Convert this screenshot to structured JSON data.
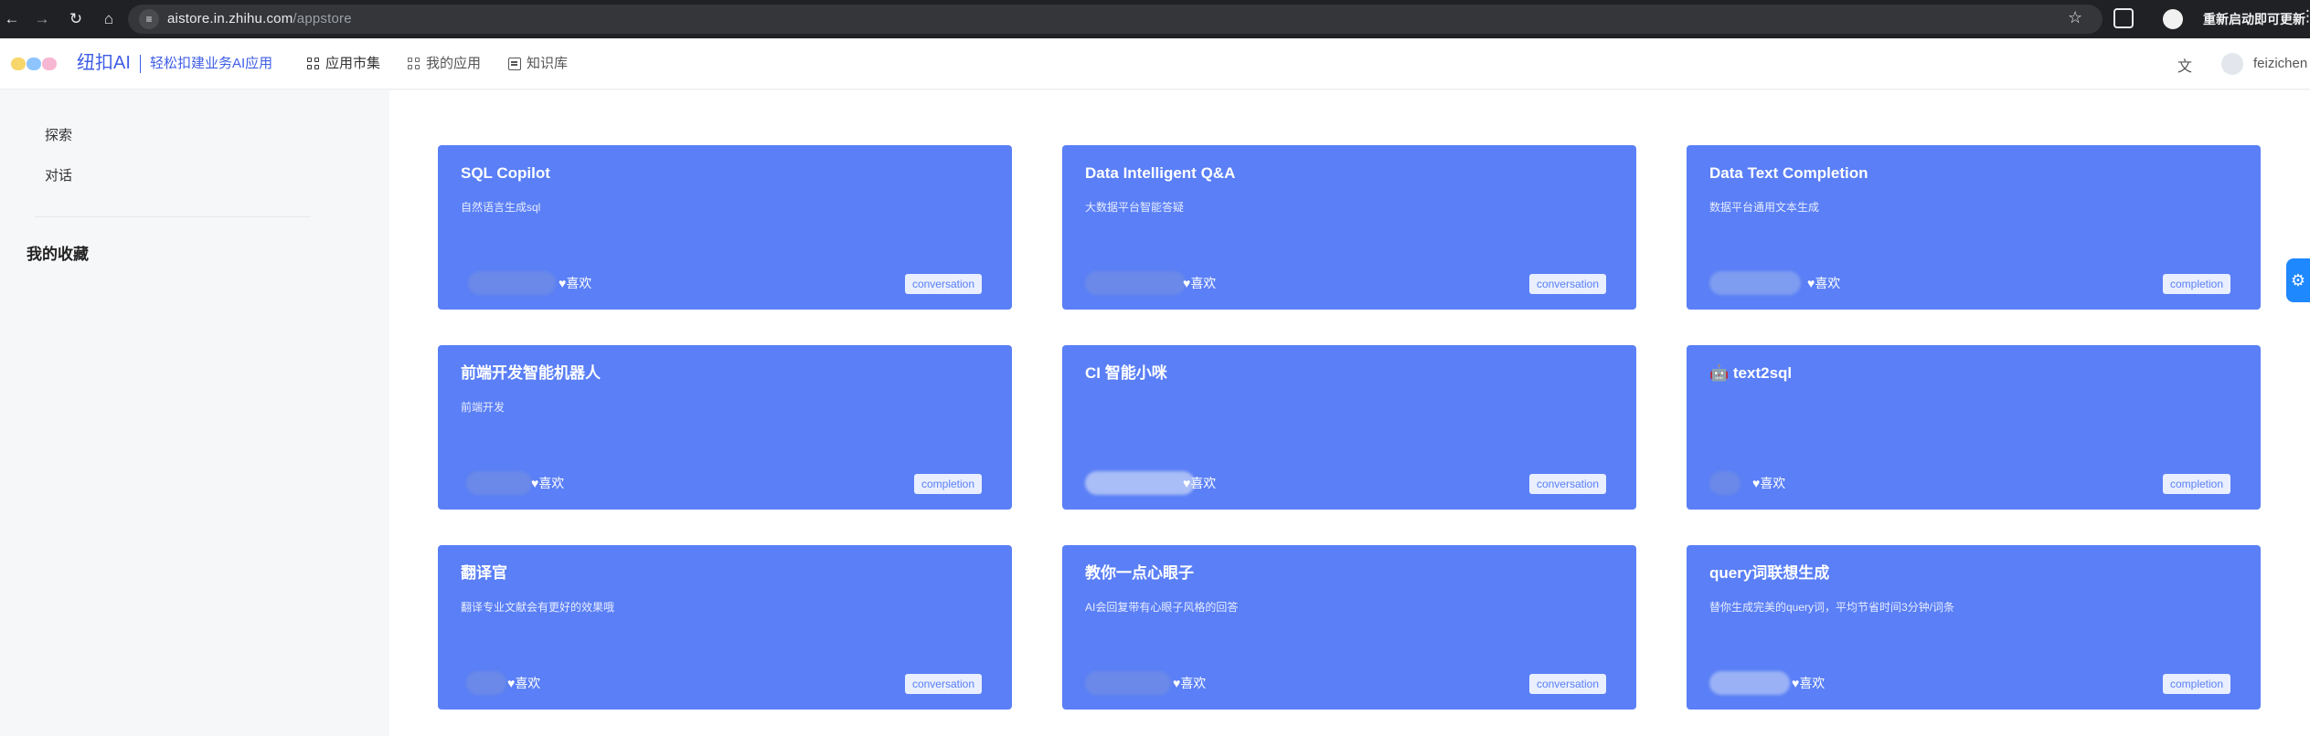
{
  "browser": {
    "url_host": "aistore.in.zhihu.com",
    "url_path": "/appstore",
    "update_label": "重新启动即可更新"
  },
  "header": {
    "brand": "纽扣AI",
    "tagline": "轻松扣建业务AI应用",
    "nav": [
      {
        "label": "应用市集",
        "icon": "grid-icon"
      },
      {
        "label": "我的应用",
        "icon": "apps-icon"
      },
      {
        "label": "知识库",
        "icon": "document-icon"
      }
    ],
    "username": "feizichen"
  },
  "sidebar": {
    "items": [
      {
        "label": "探索"
      },
      {
        "label": "对话"
      }
    ],
    "favorites_heading": "我的收藏"
  },
  "like_label": "喜欢",
  "heart": "♥",
  "cards": [
    {
      "title": "SQL Copilot",
      "desc": "自然语言生成sql",
      "tag": "conversation"
    },
    {
      "title": "Data Intelligent Q&A",
      "desc": "大数据平台智能答疑",
      "tag": "conversation"
    },
    {
      "title": "Data Text Completion",
      "desc": "数据平台通用文本生成",
      "tag": "completion"
    },
    {
      "title": "前端开发智能机器人",
      "desc": "前端开发",
      "tag": "completion"
    },
    {
      "title": "CI 智能小咪",
      "desc": "",
      "tag": "conversation"
    },
    {
      "title": "🤖 text2sql",
      "desc": "",
      "tag": "completion"
    },
    {
      "title": "翻译官",
      "desc": "翻译专业文献会有更好的效果哦",
      "tag": "conversation"
    },
    {
      "title": "教你一点心眼子",
      "desc": "AI会回复带有心眼子风格的回答",
      "tag": "conversation"
    },
    {
      "title": "query词联想生成",
      "desc": "替你生成完美的query词，平均节省时间3分钟/词条",
      "tag": "completion"
    }
  ],
  "colors": {
    "card_bg": "#5a7ff6",
    "brand": "#3f5ee6",
    "tag_bg": "#e9efff"
  }
}
